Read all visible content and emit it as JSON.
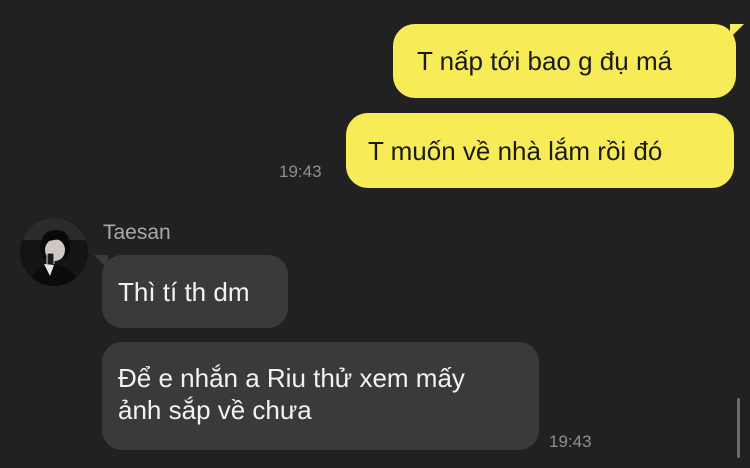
{
  "messages_out": [
    {
      "text": "T nấp tới bao g đụ má"
    },
    {
      "text": "T muốn về nhà lắm rồi đó",
      "time": "19:43"
    }
  ],
  "incoming": {
    "sender": "Taesan",
    "messages": [
      {
        "text": "Thì tí th dm"
      },
      {
        "line1": "Để e nhắn a Riu thử xem mấy",
        "line2": "ảnh sắp về chưa",
        "time": "19:43"
      }
    ]
  },
  "colors": {
    "background": "#212121",
    "outgoing_bubble": "#F7EC58",
    "incoming_bubble": "#3A3A3C"
  },
  "icons": {
    "avatar": "user-avatar"
  }
}
